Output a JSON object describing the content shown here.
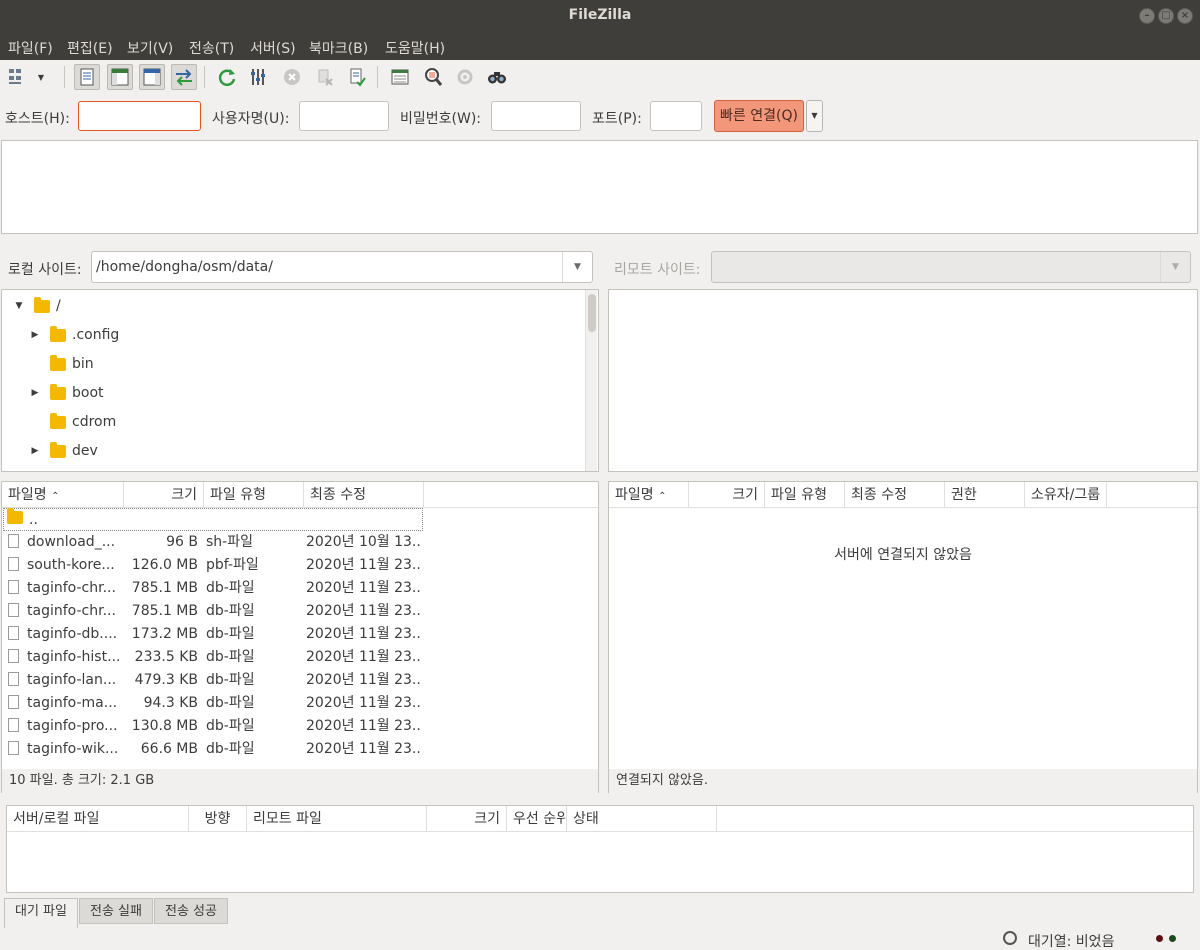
{
  "window": {
    "title": "FileZilla"
  },
  "menu": [
    "파일(F)",
    "편집(E)",
    "보기(V)",
    "전송(T)",
    "서버(S)",
    "북마크(B)",
    "도움말(H)"
  ],
  "quickconnect": {
    "host_label": "호스트(H):",
    "user_label": "사용자명(U):",
    "pass_label": "비밀번호(W):",
    "port_label": "포트(P):",
    "host_value": "",
    "user_value": "",
    "pass_value": "",
    "port_value": "",
    "connect_label": "빠른 연결(Q)"
  },
  "local": {
    "site_label": "로컬 사이트:",
    "path": "/home/dongha/osm/data/",
    "tree": [
      {
        "name": "/",
        "expander": "▼"
      },
      {
        "name": ".config",
        "expander": "▶"
      },
      {
        "name": "bin",
        "expander": ""
      },
      {
        "name": "boot",
        "expander": "▶"
      },
      {
        "name": "cdrom",
        "expander": ""
      },
      {
        "name": "dev",
        "expander": "▶"
      }
    ],
    "columns": [
      "파일명",
      "크기",
      "파일 유형",
      "최종 수정"
    ],
    "parent_dir": "..",
    "files": [
      {
        "name": "download_...",
        "size": "96 B",
        "type": "sh-파일",
        "modified": "2020년 10월 13..."
      },
      {
        "name": "south-kore...",
        "size": "126.0 MB",
        "type": "pbf-파일",
        "modified": "2020년 11월 23..."
      },
      {
        "name": "taginfo-chr...",
        "size": "785.1 MB",
        "type": "db-파일",
        "modified": "2020년 11월 23..."
      },
      {
        "name": "taginfo-chr...",
        "size": "785.1 MB",
        "type": "db-파일",
        "modified": "2020년 11월 23..."
      },
      {
        "name": "taginfo-db....",
        "size": "173.2 MB",
        "type": "db-파일",
        "modified": "2020년 11월 23..."
      },
      {
        "name": "taginfo-hist...",
        "size": "233.5 KB",
        "type": "db-파일",
        "modified": "2020년 11월 23..."
      },
      {
        "name": "taginfo-lan...",
        "size": "479.3 KB",
        "type": "db-파일",
        "modified": "2020년 11월 23..."
      },
      {
        "name": "taginfo-ma...",
        "size": "94.3 KB",
        "type": "db-파일",
        "modified": "2020년 11월 23..."
      },
      {
        "name": "taginfo-pro...",
        "size": "130.8 MB",
        "type": "db-파일",
        "modified": "2020년 11월 23..."
      },
      {
        "name": "taginfo-wik...",
        "size": "66.6 MB",
        "type": "db-파일",
        "modified": "2020년 11월 23..."
      }
    ],
    "status": "10 파일. 총 크기: 2.1 GB"
  },
  "remote": {
    "site_label": "리모트 사이트:",
    "path": "",
    "columns": [
      "파일명",
      "크기",
      "파일 유형",
      "최종 수정",
      "권한",
      "소유자/그룹"
    ],
    "empty_message": "서버에 연결되지 않았음",
    "status": "연결되지 않았음."
  },
  "queue": {
    "columns": [
      "서버/로컬 파일",
      "방향",
      "리모트 파일",
      "크기",
      "우선 순위",
      "상태"
    ],
    "tabs": [
      "대기 파일",
      "전송 실패",
      "전송 성공"
    ]
  },
  "statusbar": {
    "queue_text": "대기열: 비었음"
  },
  "colors": {
    "accent": "#e95420",
    "connect_button": "#f2977a",
    "titlebar": "#3f3e3b",
    "folder": "#f5b800"
  }
}
